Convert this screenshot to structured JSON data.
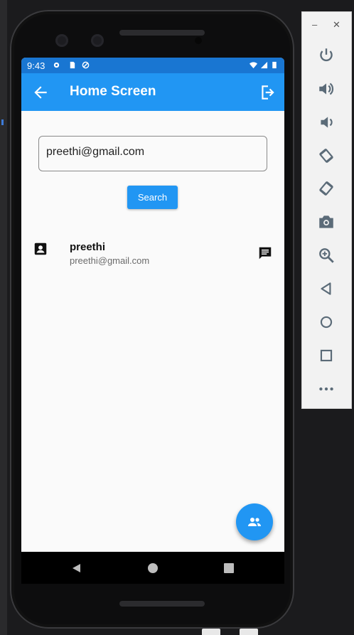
{
  "status_bar": {
    "time": "9:43"
  },
  "app_bar": {
    "title": "Home Screen",
    "back_icon": "arrow-back-icon",
    "logout_icon": "logout-icon"
  },
  "search": {
    "value": "preethi@gmail.com",
    "button_label": "Search"
  },
  "results": [
    {
      "name": "preethi",
      "email": "preethi@gmail.com",
      "leading_icon": "contact-card-icon",
      "trailing_icon": "chat-icon"
    }
  ],
  "fab": {
    "icon": "group-icon"
  },
  "emulator_controls": [
    "power",
    "volume-up",
    "volume-down",
    "rotate-left",
    "rotate-right",
    "screenshot",
    "zoom",
    "back",
    "home",
    "overview",
    "more"
  ],
  "colors": {
    "primary": "#2196f3",
    "status_bar": "#1976d2"
  }
}
